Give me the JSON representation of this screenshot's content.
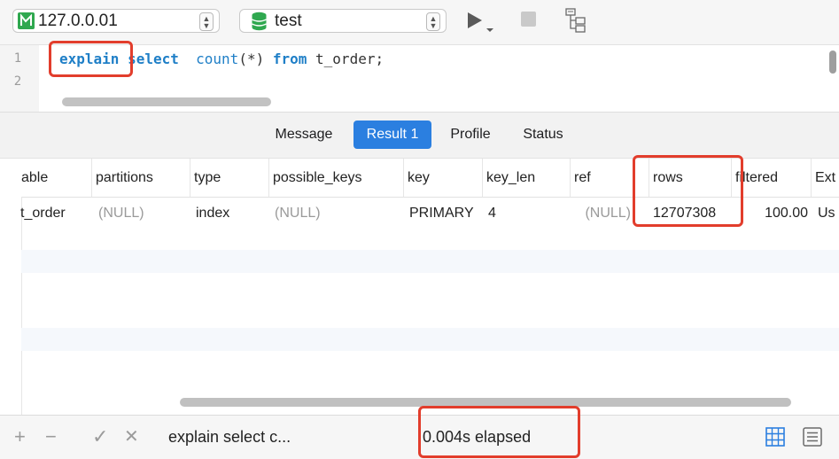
{
  "toolbar": {
    "connection": "127.0.0.01",
    "database": "test",
    "icons": {
      "connection": "connection-icon",
      "database": "database-icon",
      "run": "play-icon",
      "stop": "stop-icon",
      "explain_plan": "explain-plan-icon"
    }
  },
  "editor": {
    "line_numbers": [
      "1",
      "2"
    ],
    "line1": {
      "kw_explain": "explain",
      "kw_select": "select",
      "fn_count": "count",
      "args": "(*)",
      "kw_from": "from",
      "table": "t_order;"
    }
  },
  "tabs": [
    {
      "label": "Message",
      "active": false
    },
    {
      "label": "Result 1",
      "active": true
    },
    {
      "label": "Profile",
      "active": false
    },
    {
      "label": "Status",
      "active": false
    }
  ],
  "result": {
    "columns": [
      "able",
      "partitions",
      "type",
      "possible_keys",
      "key",
      "key_len",
      "ref",
      "rows",
      "filtered",
      "Ext"
    ],
    "rows": [
      [
        "t_order",
        "(NULL)",
        "index",
        "(NULL)",
        "PRIMARY",
        "4",
        "(NULL)",
        "12707308",
        "100.00",
        "Us"
      ]
    ]
  },
  "footer": {
    "add": "+",
    "remove": "−",
    "apply": "✓",
    "cancel": "✕",
    "query_preview": "explain select  c...",
    "elapsed": "0.004s elapsed"
  },
  "colors": {
    "accent": "#2b7fe0",
    "keyword": "#1f7fc7",
    "highlight": "#e23d2c",
    "null_text": "#9a9a9a"
  }
}
